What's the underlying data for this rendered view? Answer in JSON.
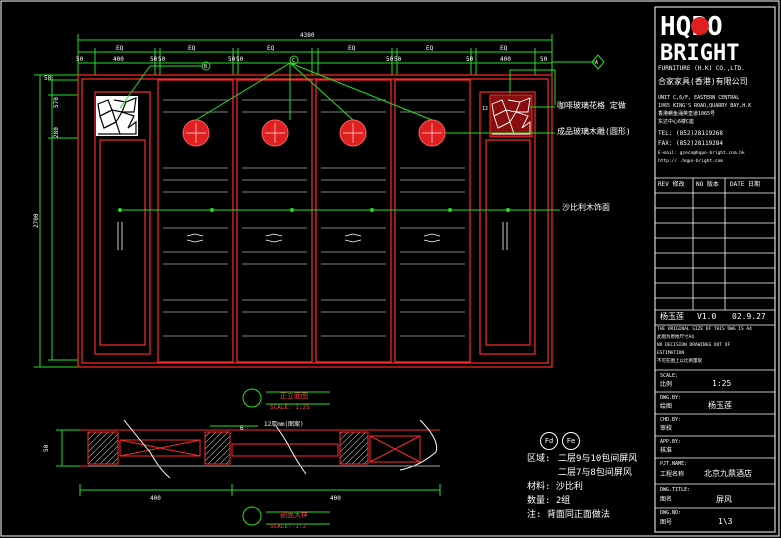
{
  "drawing": {
    "total_width": "4380",
    "height_dim": "2700",
    "top_dims": [
      "50",
      "50",
      "50",
      "50",
      "50",
      "50",
      "50",
      "50",
      "50",
      "50"
    ],
    "eq_labels": [
      "EQ",
      "EQ",
      "EQ",
      "EQ",
      "EQ",
      "EQ",
      "EQ"
    ],
    "small_dims": [
      "400",
      "400"
    ],
    "left_dims": [
      "570",
      "280"
    ],
    "callout_b": "B",
    "callout_c": "C",
    "callout_a": "A",
    "right_small": "12",
    "notes": {
      "lattice": "咖啡玻璃花格 定做",
      "carving": "成品玻璃木雕(圆形)",
      "panel": "沙比利木饰面"
    }
  },
  "section_view": {
    "elevation_title": "正立面图",
    "elevation_scale": "SCALE: 1:25",
    "section_title": "剖面大样",
    "section_scale": "SCALE: 1:2",
    "callout_12": "12",
    "glass_note": "12厚mm(图案)",
    "dim_400_left": "400",
    "dim_400_right": "400",
    "dim_50": "50",
    "dim_6": "6"
  },
  "spec": {
    "badge_1": "Fd",
    "badge_2": "Fe",
    "region_label": "区域:",
    "region_line1": "二层9与10包间屏风",
    "region_line2": "二层7与8包间屏风",
    "material": "材料: 沙比利",
    "quantity": "数量: 2组",
    "note": "注: 背面同正面做法"
  },
  "title_block": {
    "logo_line1": "HQPO",
    "logo_line2": "BRIGHT",
    "company_en": "FURNITURE (H.K) CO.,LTD.",
    "company_cn": "合家家具(香港)有限公司",
    "address": [
      "UNIT C,6/F, EASTERN CENTRAL",
      "1065 KING'S ROAD,QUARRY BAY,H.K",
      "香港鲗鱼涌英皇道1065号",
      "东达中心6楼C座"
    ],
    "tel": "TEL: (852)28119268",
    "fax": "FAX: (852)28119284",
    "email": "E-mail: gzeco@hqpo-bright.com.hk",
    "web": "http:// .hqpo-bright.com",
    "rev_headers": [
      "REV 修改",
      "NO 版本",
      "DATE 日期"
    ],
    "designer": "杨玉莲",
    "version": "V1.0",
    "date": "02.9.27",
    "disclaimer": [
      "THE ORIGINAL SIZE OF THIS DWG IS A4",
      "此图为原始尺寸A4",
      "NO DECISION DRAWINGS OUT OF",
      "ESTIMATION",
      "不可在图上以比例量取"
    ],
    "scale_label": "SCALE:",
    "scale_cn": "比例",
    "scale_value": "1:25",
    "dwg_by_label": "DWG.BY:",
    "dwg_by_cn": "绘图",
    "dwg_by_value": "杨玉莲",
    "chk_by_label": "CHD.BY:",
    "chk_by_cn": "审校",
    "app_by_label": "APP.BY:",
    "app_by_cn": "核准",
    "project_label": "PJT.NAME:",
    "project_cn": "工程名称",
    "project_value": "北京九鼎酒店",
    "title_label": "DWG.TITLE:",
    "title_cn": "图名",
    "title_value": "屏风",
    "no_label": "DWG.NO:",
    "no_cn": "图号",
    "no_value": "1\\3"
  },
  "colors": {
    "background": "#000000",
    "red": "#ff2a2a",
    "green": "#22e022",
    "white": "#ffffff",
    "yellow": "#ffff66"
  }
}
